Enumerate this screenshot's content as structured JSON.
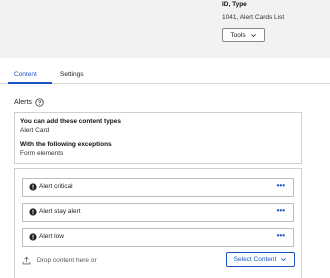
{
  "header": {
    "id_type_label": "ID, Type",
    "id_type_value": "1041, Alert Cards List",
    "tools_label": "Tools"
  },
  "tabs": [
    {
      "label": "Content",
      "active": true
    },
    {
      "label": "Settings",
      "active": false
    }
  ],
  "alerts": {
    "title": "Alerts",
    "info": {
      "allowed_heading": "You can add these content types",
      "allowed_value": "Alert Card",
      "exceptions_heading": "With the following exceptions",
      "exceptions_value": "Form elements"
    },
    "items": [
      {
        "label": "Alert critical",
        "more": "•••"
      },
      {
        "label": "Alert stay alert",
        "more": "•••"
      },
      {
        "label": "Alert low",
        "more": "•••"
      }
    ],
    "drop_text": "Drop content here or",
    "select_content_label": "Select Content"
  },
  "colors": {
    "accent": "#1a53c5",
    "header_bg": "#f2f2f2"
  }
}
